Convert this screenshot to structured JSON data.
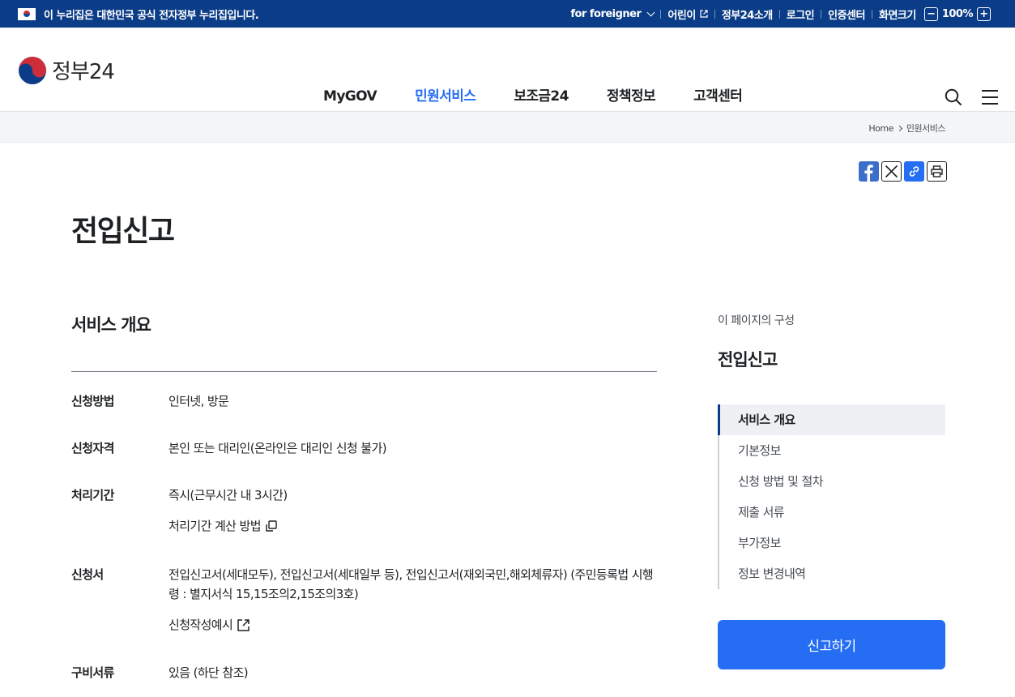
{
  "topbar": {
    "official_text": "이 누리집은 대한민국 공식 전자정부 누리집입니다.",
    "foreigner": "for foreigner",
    "kids": "어린이",
    "about": "정부24소개",
    "login": "로그인",
    "cert": "인증센터",
    "screen_size": "화면크기",
    "zoom": "100%",
    "zoom_minus": "−",
    "zoom_plus": "+"
  },
  "header": {
    "logo_text": "정부24",
    "nav": [
      "MyGOV",
      "민원서비스",
      "보조금24",
      "정책정보",
      "고객센터"
    ],
    "active_nav": "민원서비스"
  },
  "breadcrumb": [
    "Home",
    "민원서비스"
  ],
  "page": {
    "title": "전입신고"
  },
  "overview": {
    "section_title": "서비스 개요",
    "rows": [
      {
        "label": "신청방법",
        "value": "인터넷, 방문"
      },
      {
        "label": "신청자격",
        "value": "본인 또는 대리인(온라인은 대리인 신청 불가)"
      },
      {
        "label": "처리기간",
        "value": "즉시(근무시간 내 3시간)",
        "link": "처리기간 계산 방법"
      },
      {
        "label": "신청서",
        "value": "전입신고서(세대모두), 전입신고서(세대일부 등), 전입신고서(재외국민,해외체류자) (주민등록법 시행령 : 별지서식 15,15조의2,15조의3호)",
        "link": "신청작성예시"
      },
      {
        "label": "구비서류",
        "value": "있음 (하단 참조)"
      }
    ]
  },
  "aside": {
    "caption": "이 페이지의 구성",
    "title": "전입신고",
    "toc": [
      "서비스 개요",
      "기본정보",
      "신청 방법 및 절차",
      "제출 서류",
      "부가정보",
      "정보 변경내역"
    ],
    "active_toc": "서비스 개요",
    "apply_button": "신고하기"
  }
}
